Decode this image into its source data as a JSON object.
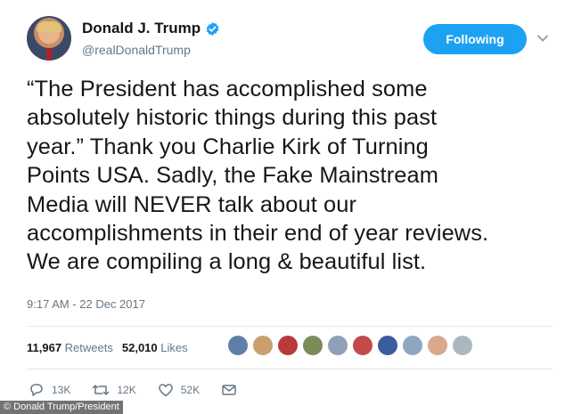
{
  "user": {
    "display_name": "Donald J. Trump",
    "handle": "@realDonaldTrump",
    "verified_color": "#1da1f2"
  },
  "follow_button": {
    "label": "Following",
    "color": "#1da1f2"
  },
  "tweet": {
    "lines": [
      "“The President has accomplished some",
      "absolutely historic things during this past",
      "year.” Thank you Charlie Kirk of Turning",
      "Points USA. Sadly, the Fake Mainstream",
      "Media will NEVER talk about our",
      "accomplishments in their end of year reviews.",
      "We are compiling a long & beautiful list."
    ],
    "timestamp": "9:17 AM - 22 Dec 2017"
  },
  "stats": {
    "retweets_count": "11,967",
    "retweets_label": "Retweets",
    "likes_count": "52,010",
    "likes_label": "Likes"
  },
  "likers": [
    "#5f7fa8",
    "#c9a06e",
    "#b83a3a",
    "#7a8c5a",
    "#8fa0b8",
    "#c44a4a",
    "#3b5c9e",
    "#90a6c0",
    "#d8a98a",
    "#aab8c2"
  ],
  "actions": {
    "reply": {
      "icon": "reply-icon",
      "count": "13K"
    },
    "retweet": {
      "icon": "retweet-icon",
      "count": "12K"
    },
    "like": {
      "icon": "heart-icon",
      "count": "52K"
    },
    "message": {
      "icon": "envelope-icon"
    }
  },
  "credit": "© Donald Trump/President"
}
